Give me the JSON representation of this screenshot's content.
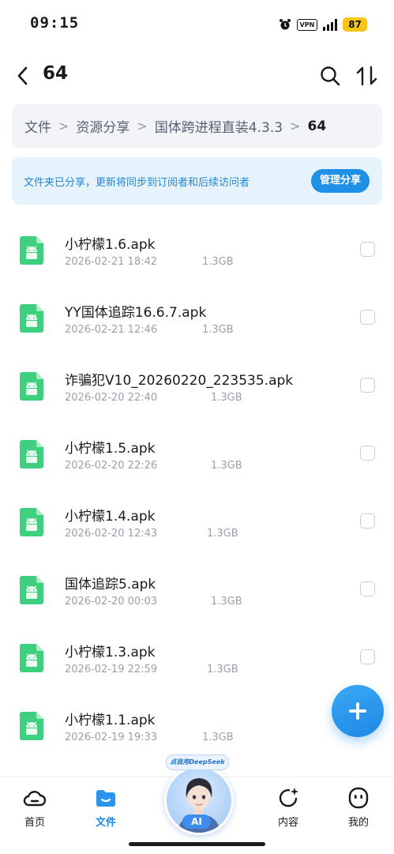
{
  "status_bar": {
    "time": "09:15",
    "vpn": "VPN",
    "battery": "87"
  },
  "header": {
    "title": "64",
    "back_icon": "chevron-left-icon",
    "search_icon": "search-icon",
    "sort_icon": "sort-icon"
  },
  "breadcrumb": {
    "items": [
      "文件",
      "资源分享",
      "国体跨进程直装4.3.3",
      "64"
    ],
    "separator": ">"
  },
  "banner": {
    "text": "文件夹已分享，更新将同步到订阅者和后续访问者",
    "button": "管理分享"
  },
  "files": [
    {
      "name": "小柠檬1.6.apk",
      "date": "2026-02-21 18:42",
      "size": "1.3GB"
    },
    {
      "name": "YY国体追踪16.6.7.apk",
      "date": "2026-02-21 12:46",
      "size": "1.3GB"
    },
    {
      "name": "诈骗犯V10_20260220_223535.apk",
      "date": "2026-02-20 22:40",
      "size": "1.3GB"
    },
    {
      "name": "小柠檬1.5.apk",
      "date": "2026-02-20 22:26",
      "size": "1.3GB"
    },
    {
      "name": "小柠檬1.4.apk",
      "date": "2026-02-20 12:43",
      "size": "1.3GB"
    },
    {
      "name": "国体追踪5.apk",
      "date": "2026-02-20 00:03",
      "size": "1.3GB"
    },
    {
      "name": "小柠檬1.3.apk",
      "date": "2026-02-19 22:59",
      "size": "1.3GB"
    },
    {
      "name": "小柠檬1.1.apk",
      "date": "2026-02-19 19:33",
      "size": "1.3GB"
    }
  ],
  "bottom_nav": {
    "home": "首页",
    "files": "文件",
    "ai_tag": "点我用DeepSeek",
    "ai_label": "AI",
    "content": "内容",
    "mine": "我的"
  },
  "colors": {
    "accent": "#1e88e5",
    "file_icon": "#3ecf7f",
    "battery": "#f5c518"
  }
}
